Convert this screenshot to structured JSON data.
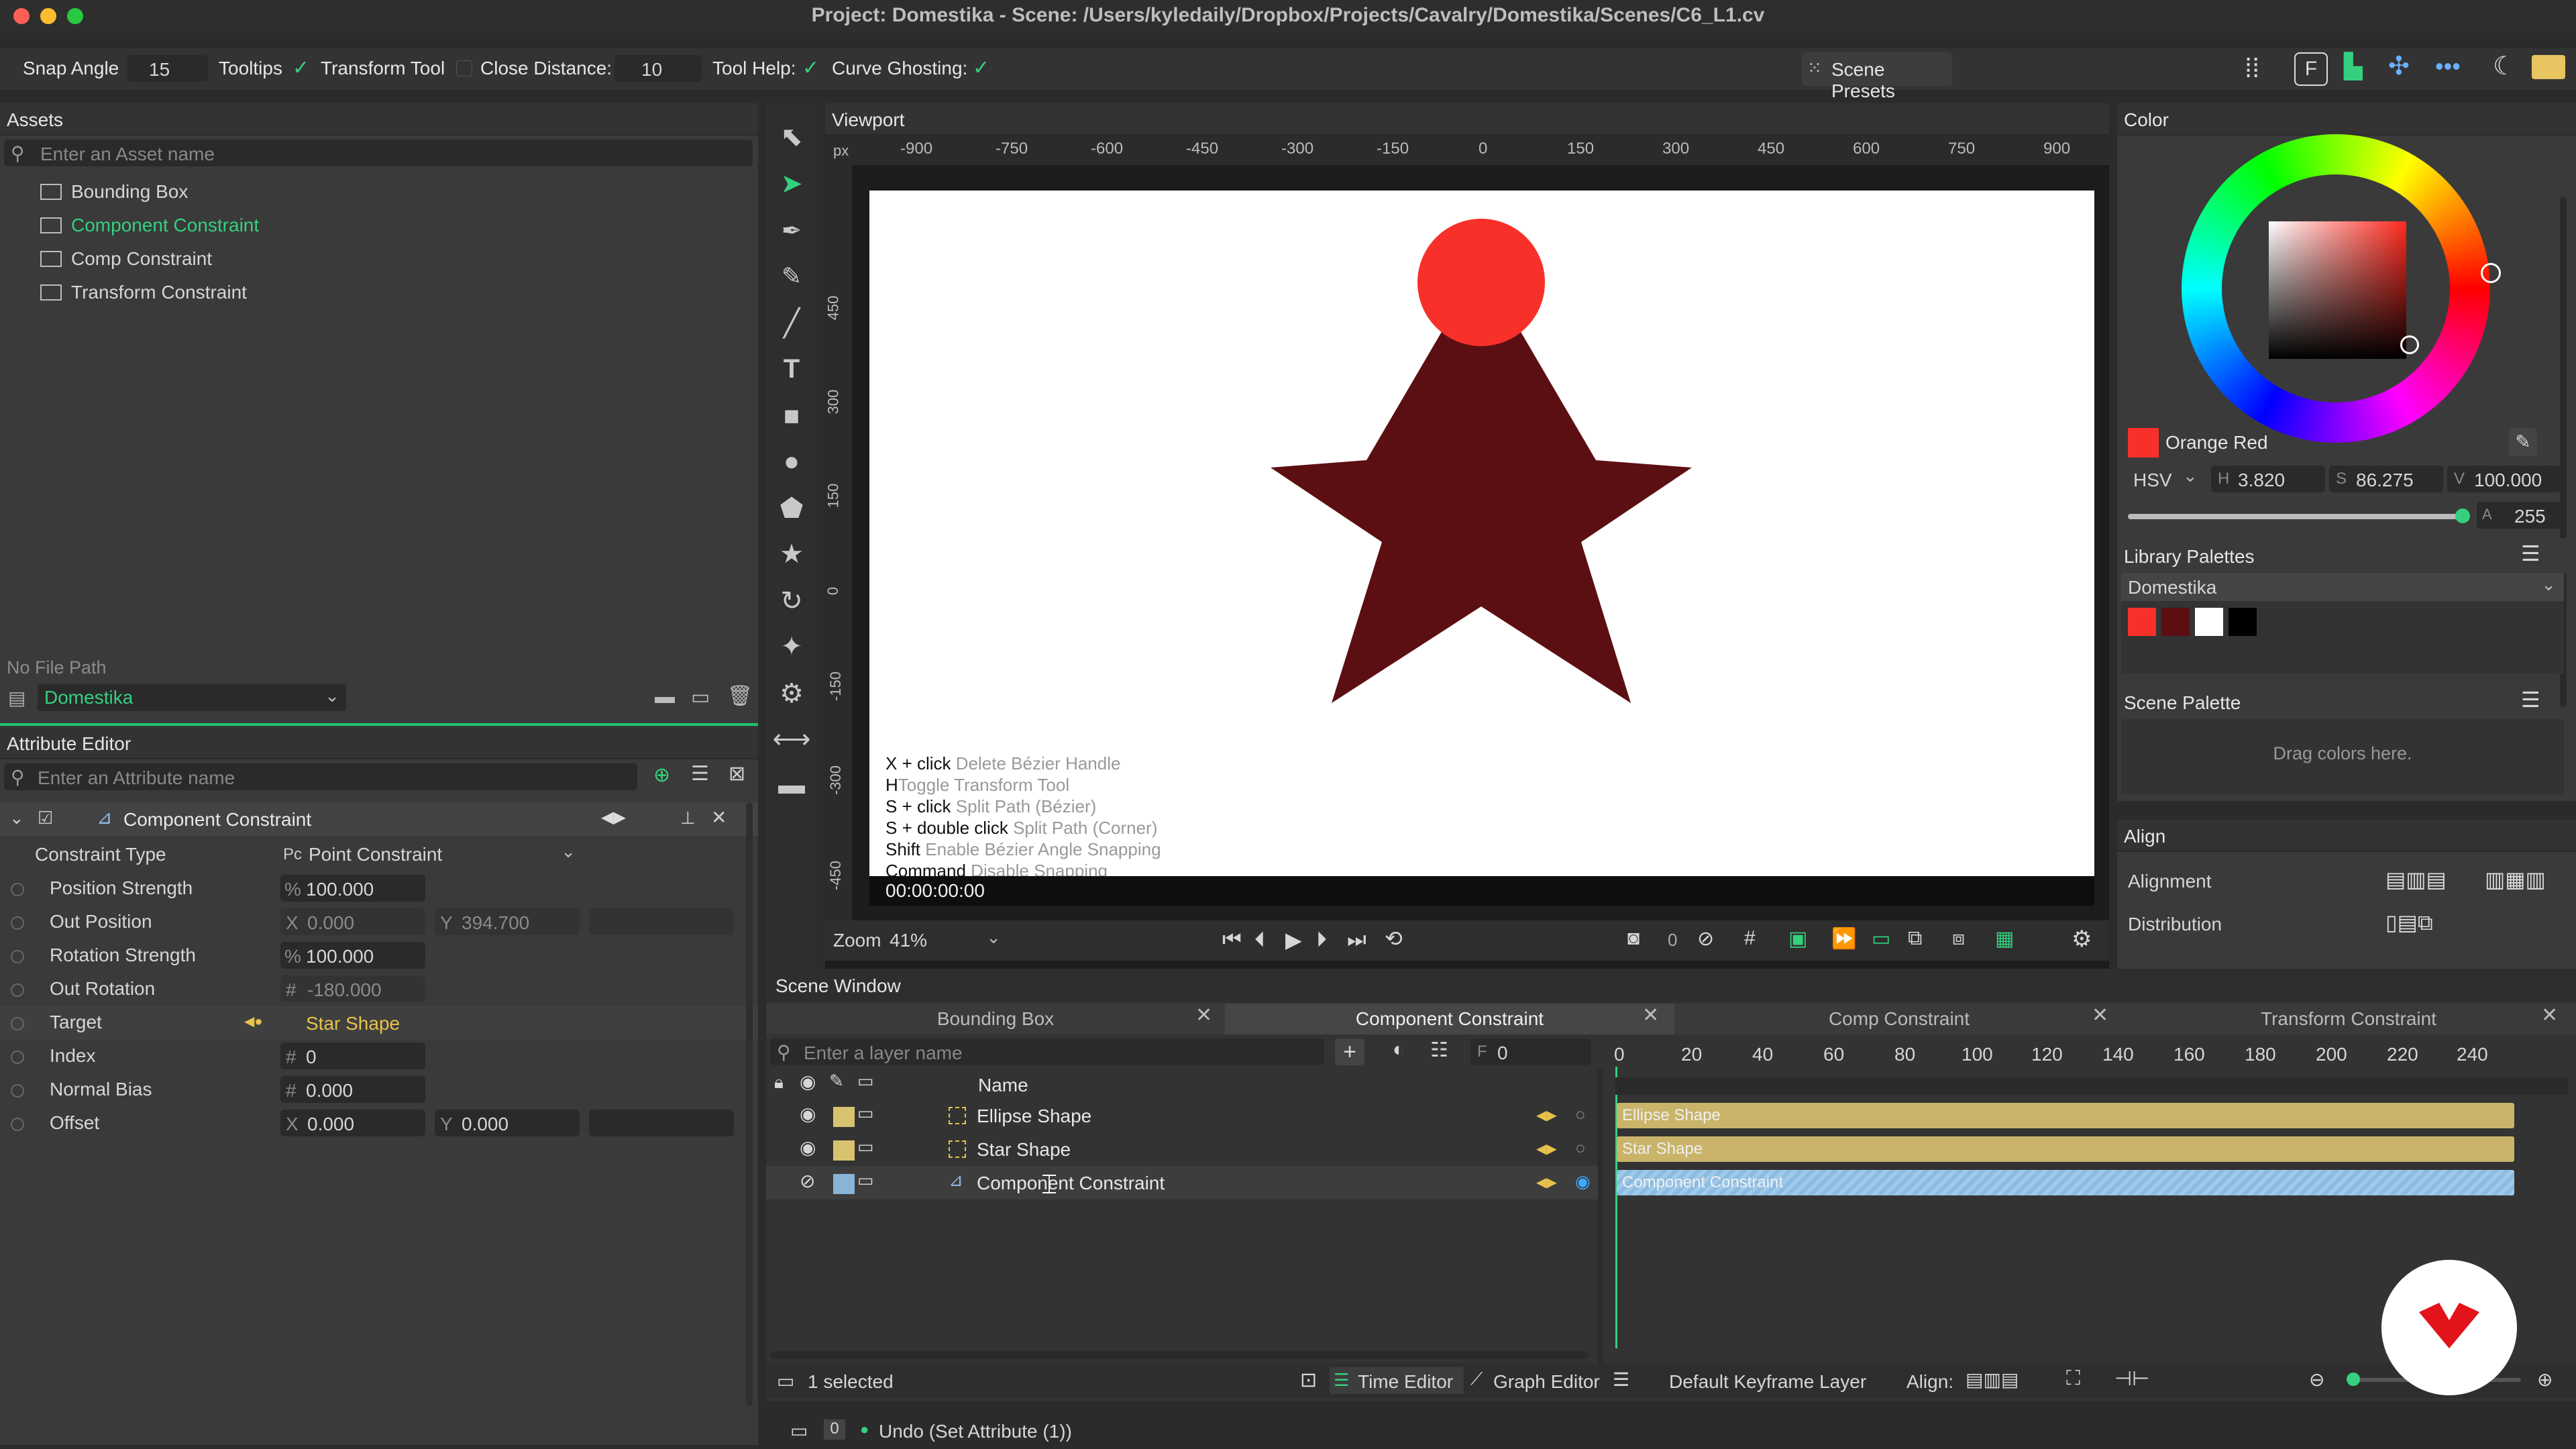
{
  "window": {
    "title": "Project: Domestika - Scene: /Users/kyledaily/Dropbox/Projects/Cavalry/Domestika/Scenes/C6_L1.cv"
  },
  "toolbar": {
    "snap_angle_label": "Snap Angle",
    "snap_angle_value": "15",
    "tooltips_label": "Tooltips",
    "transform_tool_label": "Transform Tool",
    "close_distance_label": "Close Distance:",
    "close_distance_value": "10",
    "tool_help_label": "Tool Help:",
    "curve_ghosting_label": "Curve Ghosting:",
    "scene_presets_label": "Scene Presets"
  },
  "assets": {
    "title": "Assets",
    "search_placeholder": "Enter an Asset name",
    "items": [
      "Bounding Box",
      "Component Constraint",
      "Comp Constraint",
      "Transform Constraint"
    ],
    "file_path": "No File Path",
    "project": "Domestika"
  },
  "attribute_editor": {
    "title": "Attribute Editor",
    "search_placeholder": "Enter an Attribute name",
    "layer": "Component Constraint",
    "constraint_type_label": "Constraint Type",
    "constraint_type_prefix": "Pc",
    "constraint_type_value": "Point Constraint",
    "rows": [
      {
        "label": "Position Strength",
        "prefix": "%",
        "value": "100.000"
      },
      {
        "label": "Out Position",
        "prefix": "X",
        "value": "0.000",
        "prefix2": "Y",
        "value2": "394.700"
      },
      {
        "label": "Rotation Strength",
        "prefix": "%",
        "value": "100.000"
      },
      {
        "label": "Out Rotation",
        "prefix": "#",
        "value": "-180.000"
      },
      {
        "label": "Target",
        "prefix": "",
        "value": "Star Shape"
      },
      {
        "label": "Index",
        "prefix": "#",
        "value": "0"
      },
      {
        "label": "Normal Bias",
        "prefix": "#",
        "value": "0.000"
      },
      {
        "label": "Offset",
        "prefix": "X",
        "value": "0.000",
        "prefix2": "Y",
        "value2": "0.000"
      }
    ]
  },
  "viewport": {
    "title": "Viewport",
    "ruler_unit": "px",
    "ruler_x": [
      "-900",
      "-750",
      "-600",
      "-450",
      "-300",
      "-150",
      "0",
      "150",
      "300",
      "450",
      "600",
      "750",
      "900"
    ],
    "ruler_y": [
      "450",
      "300",
      "150",
      "0",
      "-150",
      "-300",
      "-450"
    ],
    "help": [
      {
        "key": "X + click",
        "desc": "Delete Bézier Handle"
      },
      {
        "key": "H",
        "desc": "Toggle Transform Tool"
      },
      {
        "key": "S + click",
        "desc": "Split Path (Bézier)"
      },
      {
        "key": "S + double click",
        "desc": "Split Path (Corner)"
      },
      {
        "key": "Shift",
        "desc": "Enable Bézier Angle Snapping"
      },
      {
        "key": "Command",
        "desc": "Disable Snapping"
      }
    ],
    "timecode": "00:00:00:00",
    "zoom_label": "Zoom",
    "zoom_value": "41%",
    "frame_value": "0",
    "circle_color": "#f8302a",
    "star_color": "#5c0f12"
  },
  "color_panel": {
    "title": "Color",
    "swatch_name": "Orange Red",
    "swatch_color": "#f8302a",
    "mode": "HSV",
    "h": "3.820",
    "s": "86.275",
    "v": "100.000",
    "h_label": "H",
    "s_label": "S",
    "v_label": "V",
    "alpha_label": "A",
    "alpha": "255",
    "library_title": "Library Palettes",
    "library_name": "Domestika",
    "library_colors": [
      "#f8302a",
      "#5c0f12",
      "#ffffff",
      "#000000"
    ],
    "scene_palette_title": "Scene Palette",
    "scene_palette_hint": "Drag colors here."
  },
  "align_panel": {
    "title": "Align",
    "alignment_label": "Alignment",
    "distribution_label": "Distribution"
  },
  "scene_window": {
    "title": "Scene Window",
    "tabs": [
      "Bounding Box",
      "Component Constraint",
      "Comp Constraint",
      "Transform Constraint"
    ],
    "layer_search_placeholder": "Enter a layer name",
    "frame_prefix": "F",
    "frame_value": "0",
    "name_header": "Name",
    "layers": [
      {
        "name": "Ellipse Shape",
        "color": "#d8c270"
      },
      {
        "name": "Star Shape",
        "color": "#d8c270"
      },
      {
        "name": "Component Constraint",
        "color": "#88b4d8"
      }
    ],
    "timeline_ticks": [
      "0",
      "20",
      "40",
      "60",
      "80",
      "100",
      "120",
      "140",
      "160",
      "180",
      "200",
      "220",
      "240"
    ],
    "selected": "1 selected",
    "time_editor": "Time Editor",
    "graph_editor": "Graph Editor",
    "keyframe_layer": "Default Keyframe Layer",
    "align_label": "Align:"
  },
  "status": {
    "message": "Undo (Set Attribute (1))",
    "count": "0"
  }
}
